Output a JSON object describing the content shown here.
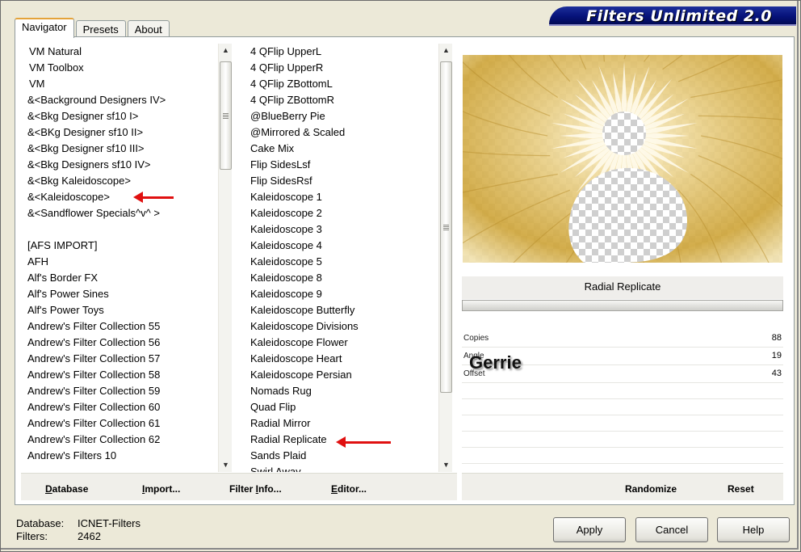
{
  "app": {
    "title": "Filters Unlimited 2.0"
  },
  "tabs": [
    {
      "label": "Navigator",
      "active": true
    },
    {
      "label": "Presets",
      "active": false
    },
    {
      "label": "About",
      "active": false
    }
  ],
  "categories": [
    {
      "label": "VM Natural",
      "indent": true
    },
    {
      "label": "VM Toolbox",
      "indent": true
    },
    {
      "label": "VM",
      "indent": true
    },
    {
      "label": "&<Background Designers IV>"
    },
    {
      "label": "&<Bkg Designer sf10 I>"
    },
    {
      "label": "&<BKg Designer sf10 II>"
    },
    {
      "label": "&<Bkg Designer sf10 III>"
    },
    {
      "label": "&<Bkg Designers sf10 IV>"
    },
    {
      "label": "&<Bkg Kaleidoscope>",
      "marked": true
    },
    {
      "label": "&<Kaleidoscope>"
    },
    {
      "label": "&<Sandflower Specials^v^ >"
    },
    {
      "label": ""
    },
    {
      "label": "[AFS IMPORT]"
    },
    {
      "label": "AFH"
    },
    {
      "label": "Alf's Border FX"
    },
    {
      "label": "Alf's Power Sines"
    },
    {
      "label": "Alf's Power Toys"
    },
    {
      "label": "Andrew's Filter Collection 55"
    },
    {
      "label": "Andrew's Filter Collection 56"
    },
    {
      "label": "Andrew's Filter Collection 57"
    },
    {
      "label": "Andrew's Filter Collection 58"
    },
    {
      "label": "Andrew's Filter Collection 59"
    },
    {
      "label": "Andrew's Filter Collection 60"
    },
    {
      "label": "Andrew's Filter Collection 61"
    },
    {
      "label": "Andrew's Filter Collection 62"
    },
    {
      "label": "Andrew's Filters 10"
    }
  ],
  "filters": [
    {
      "label": "4 QFlip UpperL"
    },
    {
      "label": "4 QFlip UpperR"
    },
    {
      "label": "4 QFlip ZBottomL"
    },
    {
      "label": "4 QFlip ZBottomR"
    },
    {
      "label": "@BlueBerry Pie"
    },
    {
      "label": "@Mirrored & Scaled"
    },
    {
      "label": "Cake Mix"
    },
    {
      "label": "Flip SidesLsf"
    },
    {
      "label": "Flip SidesRsf"
    },
    {
      "label": "Kaleidoscope 1"
    },
    {
      "label": "Kaleidoscope 2"
    },
    {
      "label": "Kaleidoscope 3"
    },
    {
      "label": "Kaleidoscope 4"
    },
    {
      "label": "Kaleidoscope 5"
    },
    {
      "label": "Kaleidoscope 8"
    },
    {
      "label": "Kaleidoscope 9"
    },
    {
      "label": "Kaleidoscope Butterfly"
    },
    {
      "label": "Kaleidoscope Divisions"
    },
    {
      "label": "Kaleidoscope Flower"
    },
    {
      "label": "Kaleidoscope Heart"
    },
    {
      "label": "Kaleidoscope Persian"
    },
    {
      "label": "Nomads Rug"
    },
    {
      "label": "Quad Flip"
    },
    {
      "label": "Radial Mirror"
    },
    {
      "label": "Radial Replicate",
      "marked": true
    },
    {
      "label": "Sands Plaid"
    },
    {
      "label": "Swirl Away"
    }
  ],
  "left_buttons": {
    "database": {
      "underline": "D",
      "rest": "atabase"
    },
    "import": {
      "underline": "I",
      "rest": "mport..."
    },
    "filter_info": {
      "pre": "Filter ",
      "underline": "I",
      "rest": "nfo..."
    },
    "editor": {
      "underline": "E",
      "rest": "ditor..."
    }
  },
  "right_buttons": {
    "randomize": "Randomize",
    "reset": "Reset"
  },
  "filter": {
    "name": "Radial Replicate",
    "params": [
      {
        "name": "Copies",
        "value": "88"
      },
      {
        "name": "Angle",
        "value": "19"
      },
      {
        "name": "Offset",
        "value": "43"
      }
    ]
  },
  "watermark": "Gerrie",
  "status": {
    "database_label": "Database:",
    "database_value": "ICNET-Filters",
    "filters_label": "Filters:",
    "filters_value": "2462"
  },
  "dialog": {
    "apply": "Apply",
    "cancel": "Cancel",
    "help": "Help"
  },
  "colors": {
    "banner": "#06127a",
    "arrow": "#e01010",
    "tab_accent": "#e4a33a",
    "preview_gold": "#d4ae4a"
  }
}
